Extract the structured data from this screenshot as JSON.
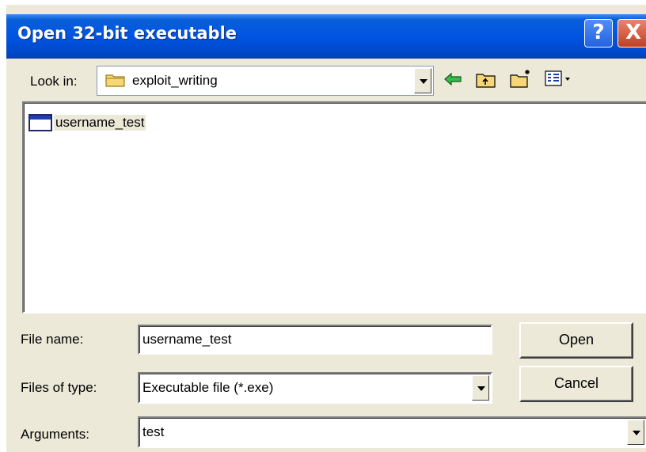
{
  "dialog": {
    "title": "Open 32-bit executable",
    "help_label": "?",
    "close_label": "X"
  },
  "look_in": {
    "label": "Look in:",
    "value": "exploit_writing",
    "icons": [
      "folder-icon",
      "back-arrow-icon",
      "up-folder-icon",
      "new-folder-icon",
      "view-menu-icon"
    ]
  },
  "file_list": {
    "items": [
      {
        "name": "username_test",
        "icon": "application-icon"
      }
    ]
  },
  "file_name": {
    "label": "File name:",
    "value": "username_test"
  },
  "files_of_type": {
    "label": "Files of type:",
    "value": "Executable file (*.exe)"
  },
  "arguments": {
    "label": "Arguments:",
    "value": "test"
  },
  "buttons": {
    "open": "Open",
    "cancel": "Cancel"
  }
}
